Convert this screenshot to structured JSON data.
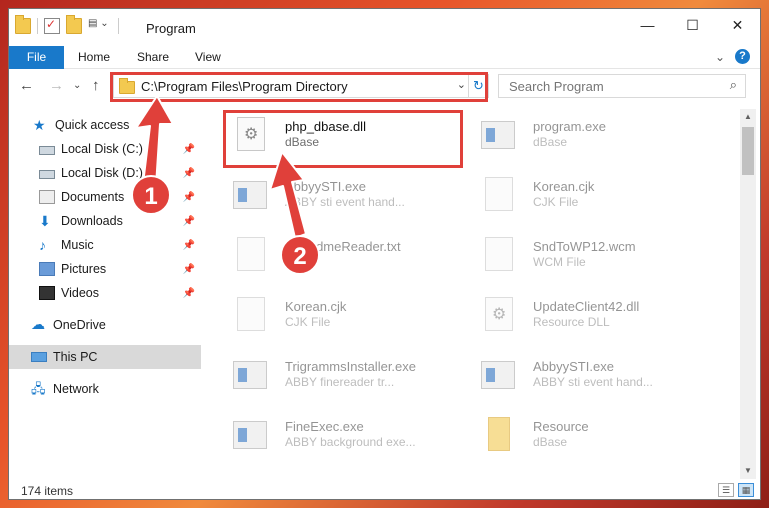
{
  "window": {
    "title": "Program",
    "minimize": "—",
    "maximize": "☐",
    "close": "✕"
  },
  "ribbon": {
    "tabs": [
      "File",
      "Home",
      "Share",
      "View"
    ],
    "collapse_glyph": "⌄",
    "help_glyph": "?"
  },
  "nav": {
    "back": "←",
    "forward": "→",
    "recent": "⌄",
    "up": "↑",
    "address": "C:\\Program Files\\Program Directory",
    "address_dropdown": "⌄",
    "refresh": "↻",
    "search_placeholder": "Search Program",
    "search_glyph": "⌕"
  },
  "sidebar": {
    "items": [
      {
        "label": "Quick access",
        "icon": "star-icon",
        "pinned": false
      },
      {
        "label": "Local Disk (C:)",
        "icon": "drive-icon",
        "pinned": true
      },
      {
        "label": "Local Disk (D:)",
        "icon": "drive-icon",
        "pinned": true
      },
      {
        "label": "Documents",
        "icon": "documents-icon",
        "pinned": true
      },
      {
        "label": "Downloads",
        "icon": "download-icon",
        "pinned": true
      },
      {
        "label": "Music",
        "icon": "music-icon",
        "pinned": true
      },
      {
        "label": "Pictures",
        "icon": "pictures-icon",
        "pinned": true
      },
      {
        "label": "Videos",
        "icon": "videos-icon",
        "pinned": true
      },
      {
        "label": "OneDrive",
        "icon": "onedrive-icon",
        "pinned": false
      },
      {
        "label": "This PC",
        "icon": "pc-icon",
        "pinned": false,
        "selected": true
      },
      {
        "label": "Network",
        "icon": "network-icon",
        "pinned": false
      }
    ],
    "pin_glyph": "📌"
  },
  "files": [
    {
      "name": "php_dbase.dll",
      "type": "dBase",
      "icon": "dll-gear-icon"
    },
    {
      "name": "program.exe",
      "type": "dBase",
      "icon": "exe-icon"
    },
    {
      "name": "AbbyySTI.exe",
      "type": "ABBY sti event hand...",
      "icon": "exe-icon"
    },
    {
      "name": "Korean.cjk",
      "type": "CJK File",
      "icon": "file-icon"
    },
    {
      "name": "hReadmeReader.txt",
      "type": "TXT",
      "icon": "file-icon"
    },
    {
      "name": "SndToWP12.wcm",
      "type": "WCM File",
      "icon": "file-icon"
    },
    {
      "name": "Korean.cjk",
      "type": "CJK File",
      "icon": "file-icon"
    },
    {
      "name": "UpdateClient42.dll",
      "type": "Resource DLL",
      "icon": "dll-gear-icon"
    },
    {
      "name": "TrigrammsInstaller.exe",
      "type": "ABBY finereader tr...",
      "icon": "exe-icon"
    },
    {
      "name": "AbbyySTI.exe",
      "type": "ABBY sti event hand...",
      "icon": "exe-icon"
    },
    {
      "name": "FineExec.exe",
      "type": "ABBY background exe...",
      "icon": "exe-icon"
    },
    {
      "name": "Resource",
      "type": "dBase",
      "icon": "folder-icon"
    }
  ],
  "status": {
    "count": "174 items"
  },
  "annotations": {
    "step1": "1",
    "step2": "2",
    "color": "#e0403a"
  }
}
